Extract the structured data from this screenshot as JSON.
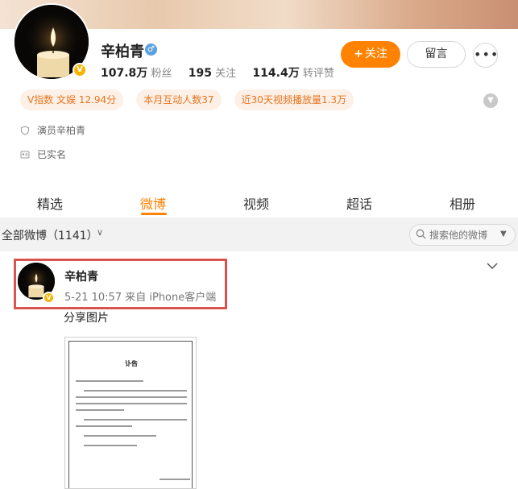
{
  "profile": {
    "name": "辛柏青",
    "gender_icon": "male-icon",
    "verified_icon": "verified-v-icon",
    "followers_value": "107.8万",
    "followers_label": "粉丝",
    "following_value": "195",
    "following_label": "关注",
    "likes_value": "114.4万",
    "likes_label": "转评赞",
    "follow_button": "关注",
    "follow_plus": "+",
    "message_button": "留言",
    "more_button": "•••"
  },
  "tags": [
    "V指数 文娱 12.94分",
    "本月互动人数37",
    "近30天视频播放量1.3万"
  ],
  "info": {
    "verified_text": "演员辛柏青",
    "realname_text": "已实名"
  },
  "tabs": [
    "精选",
    "微博",
    "视频",
    "超话",
    "相册"
  ],
  "active_tab": "微博",
  "filter": {
    "label": "全部微博（1141）",
    "search_placeholder": "搜索他的微博"
  },
  "post": {
    "author": "辛柏青",
    "meta": "5-21 10:57  来自 iPhone客户端",
    "text": "分享图片",
    "image_title": "讣告"
  },
  "colors": {
    "accent": "#ff8200",
    "tag_text": "#e8741f",
    "tag_bg": "#fdf0e6",
    "highlight_border": "#d9534f",
    "verified_badge": "#f7b500"
  }
}
